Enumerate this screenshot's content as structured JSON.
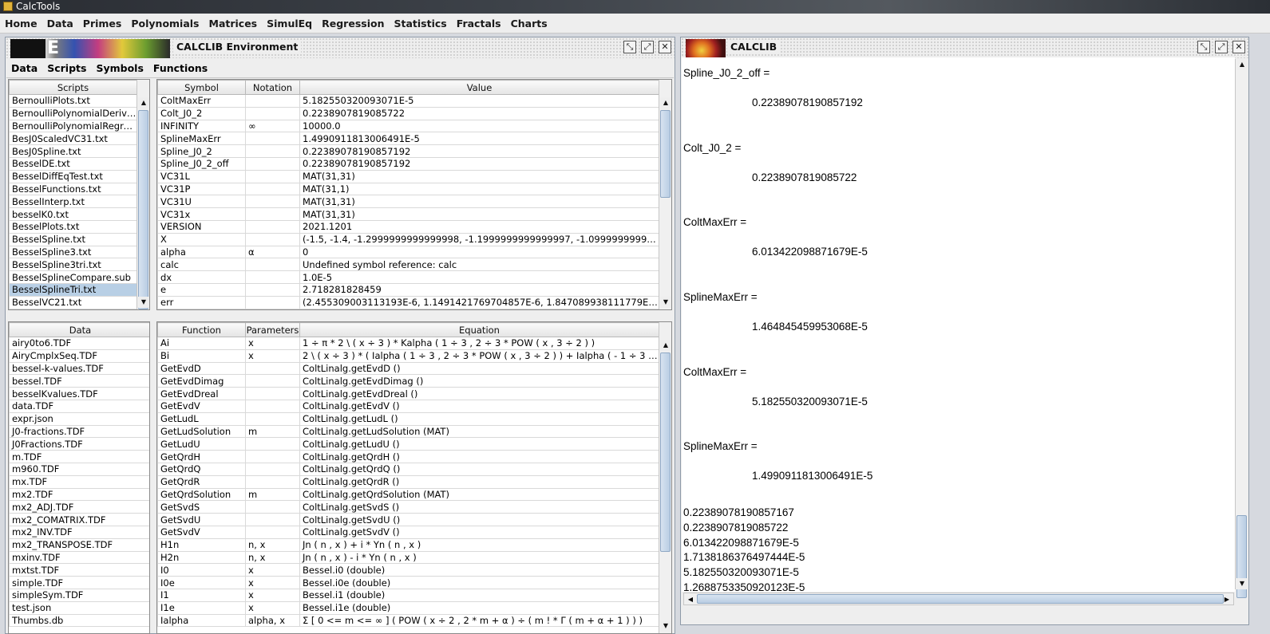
{
  "app": {
    "title": "CalcTools"
  },
  "menubar": [
    "Home",
    "Data",
    "Primes",
    "Polynomials",
    "Matrices",
    "SimulEq",
    "Regression",
    "Statistics",
    "Fractals",
    "Charts"
  ],
  "env_frame": {
    "logo_letter": "E",
    "title": "CALCLIB Environment",
    "menu": [
      "Data",
      "Scripts",
      "Symbols",
      "Functions"
    ],
    "scripts": {
      "header": "Scripts",
      "items": [
        "BernoulliPlots.txt",
        "BernoulliPolynomialDerivat...",
        "BernoulliPolynomialRegre...",
        "BesJ0ScaledVC31.txt",
        "BesJ0Spline.txt",
        "BesselDE.txt",
        "BesselDiffEqTest.txt",
        "BesselFunctions.txt",
        "BesselInterp.txt",
        "besselK0.txt",
        "BesselPlots.txt",
        "BesselSpline.txt",
        "BesselSpline3.txt",
        "BesselSpline3tri.txt",
        "BesselSplineCompare.sub",
        "BesselSplineTri.txt",
        "BesselVC21.txt"
      ],
      "selected_index": 15
    },
    "symbols": {
      "headers": [
        "Symbol",
        "Notation",
        "Value"
      ],
      "rows": [
        [
          "ColtMaxErr",
          "",
          "5.182550320093071E-5"
        ],
        [
          "Colt_J0_2",
          "",
          "0.2238907819085722"
        ],
        [
          "INFINITY",
          "∞",
          "10000.0"
        ],
        [
          "SplineMaxErr",
          "",
          "1.4990911813006491E-5"
        ],
        [
          "Spline_J0_2",
          "",
          "0.22389078190857192"
        ],
        [
          "Spline_J0_2_off",
          "",
          "0.22389078190857192"
        ],
        [
          "VC31L",
          "",
          "MAT(31,31)"
        ],
        [
          "VC31P",
          "",
          "MAT(31,1)"
        ],
        [
          "VC31U",
          "",
          "MAT(31,31)"
        ],
        [
          "VC31x",
          "",
          "MAT(31,31)"
        ],
        [
          "VERSION",
          "",
          "2021.1201"
        ],
        [
          "X",
          "",
          "(-1.5, -1.4, -1.2999999999999998, -1.1999999999999997, -1.0999999999999999..."
        ],
        [
          "alpha",
          "α",
          "0"
        ],
        [
          "calc",
          "",
          "Undefined symbol reference: calc"
        ],
        [
          "dx",
          "",
          "1.0E-5"
        ],
        [
          "e",
          "",
          "2.718281828459"
        ],
        [
          "err",
          "",
          "(2.455309003113193E-6, 1.1491421769704857E-6, 1.847089938111779E-6, 3...."
        ]
      ]
    },
    "data": {
      "header": "Data",
      "items": [
        "airy0to6.TDF",
        "AiryCmplxSeq.TDF",
        "bessel-k-values.TDF",
        "bessel.TDF",
        "besselKvalues.TDF",
        "data.TDF",
        "expr.json",
        "J0-fractions.TDF",
        "J0Fractions.TDF",
        "m.TDF",
        "m960.TDF",
        "mx.TDF",
        "mx2.TDF",
        "mx2_ADJ.TDF",
        "mx2_COMATRIX.TDF",
        "mx2_INV.TDF",
        "mx2_TRANSPOSE.TDF",
        "mxinv.TDF",
        "mxtst.TDF",
        "simple.TDF",
        "simpleSym.TDF",
        "test.json",
        "Thumbs.db"
      ]
    },
    "functions": {
      "headers": [
        "Function",
        "Parameters",
        "Equation"
      ],
      "rows": [
        [
          "Ai",
          "x",
          "1 ÷ π * 2 \\ ( x ÷ 3 ) * Kalpha ( 1 ÷ 3 , 2 ÷ 3 * POW ( x , 3 ÷ 2 ) )"
        ],
        [
          "Bi",
          "x",
          "2 \\ ( x ÷ 3 ) * ( Ialpha ( 1 ÷ 3 , 2 ÷ 3 * POW ( x , 3 ÷ 2 ) ) + Ialpha ( - 1 ÷ 3 , 2 ÷ 3 * PO..."
        ],
        [
          "GetEvdD",
          "",
          "ColtLinalg.getEvdD ()"
        ],
        [
          "GetEvdDimag",
          "",
          "ColtLinalg.getEvdDimag ()"
        ],
        [
          "GetEvdDreal",
          "",
          "ColtLinalg.getEvdDreal ()"
        ],
        [
          "GetEvdV",
          "",
          "ColtLinalg.getEvdV ()"
        ],
        [
          "GetLudL",
          "",
          "ColtLinalg.getLudL ()"
        ],
        [
          "GetLudSolution",
          "m",
          "ColtLinalg.getLudSolution (MAT)"
        ],
        [
          "GetLudU",
          "",
          "ColtLinalg.getLudU ()"
        ],
        [
          "GetQrdH",
          "",
          "ColtLinalg.getQrdH ()"
        ],
        [
          "GetQrdQ",
          "",
          "ColtLinalg.getQrdQ ()"
        ],
        [
          "GetQrdR",
          "",
          "ColtLinalg.getQrdR ()"
        ],
        [
          "GetQrdSolution",
          "m",
          "ColtLinalg.getQrdSolution (MAT)"
        ],
        [
          "GetSvdS",
          "",
          "ColtLinalg.getSvdS ()"
        ],
        [
          "GetSvdU",
          "",
          "ColtLinalg.getSvdU ()"
        ],
        [
          "GetSvdV",
          "",
          "ColtLinalg.getSvdV ()"
        ],
        [
          "H1n",
          "n, x",
          "Jn ( n , x ) + i * Yn ( n , x )"
        ],
        [
          "H2n",
          "n, x",
          "Jn ( n , x ) - i * Yn ( n , x )"
        ],
        [
          "I0",
          "x",
          "Bessel.i0 (double)"
        ],
        [
          "I0e",
          "x",
          "Bessel.i0e (double)"
        ],
        [
          "I1",
          "x",
          "Bessel.i1 (double)"
        ],
        [
          "I1e",
          "x",
          "Bessel.i1e (double)"
        ],
        [
          "Ialpha",
          "alpha, x",
          "Σ [ 0 <= m <= ∞ ] ( POW ( x ÷ 2 , 2 * m + α ) ÷ ( m ! * Γ ( m + α + 1 ) ) )"
        ]
      ]
    }
  },
  "calc_frame": {
    "title": "CALCLIB",
    "blocks": [
      {
        "name": "Spline_J0_2_off =",
        "value": "0.22389078190857192"
      },
      {
        "name": "Colt_J0_2 =",
        "value": "0.2238907819085722"
      },
      {
        "name": "ColtMaxErr =",
        "value": "6.013422098871679E-5"
      },
      {
        "name": "SplineMaxErr =",
        "value": "1.464845459953068E-5"
      },
      {
        "name": "ColtMaxErr =",
        "value": "5.182550320093071E-5"
      },
      {
        "name": "SplineMaxErr =",
        "value": "1.4990911813006491E-5"
      }
    ],
    "plain_lines": [
      "0.22389078190857167",
      "0.2238907819085722",
      "6.013422098871679E-5",
      "1.7138186376497444E-5",
      "5.182550320093071E-5",
      "1.2688753350920123E-5"
    ]
  }
}
